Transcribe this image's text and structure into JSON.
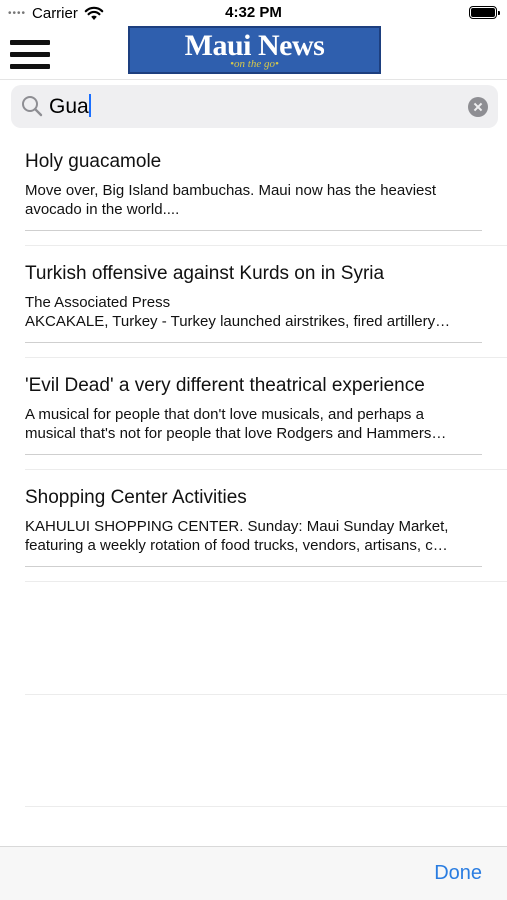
{
  "status_bar": {
    "signal_dots": "••••",
    "carrier": "Carrier",
    "wifi_icon": "wifi-icon",
    "time": "4:32 PM",
    "battery_icon": "battery-icon"
  },
  "nav": {
    "menu_icon": "hamburger-menu-icon",
    "logo_title": "Maui News",
    "logo_tagline": "•on the go•",
    "logo_bg": "#2f5fae"
  },
  "search": {
    "value": "Gua",
    "search_icon": "magnifier-icon",
    "clear_icon": "clear-x-icon"
  },
  "results": [
    {
      "title": "Holy guacamole",
      "lines": [
        "Move over, Big Island bambuchas. Maui now has the heaviest",
        "avocado in the world...."
      ]
    },
    {
      "title": "Turkish offensive against Kurds on in Syria",
      "lines": [
        "The Associated Press",
        "AKCAKALE, Turkey - Turkey launched airstrikes, fired artillery…"
      ]
    },
    {
      "title": "'Evil Dead' a very different theatrical experience",
      "lines": [
        "A musical for people that don't love musicals, and perhaps a",
        "musical that's not for people that love Rodgers and Hammers…"
      ]
    },
    {
      "title": "Shopping Center Activities",
      "lines": [
        "KAHULUI SHOPPING CENTER. Sunday: Maui Sunday Market,",
        "featuring a weekly rotation of food trucks, vendors, artisans, c…"
      ]
    }
  ],
  "toolbar": {
    "done_label": "Done",
    "accent": "#2a7de1"
  }
}
